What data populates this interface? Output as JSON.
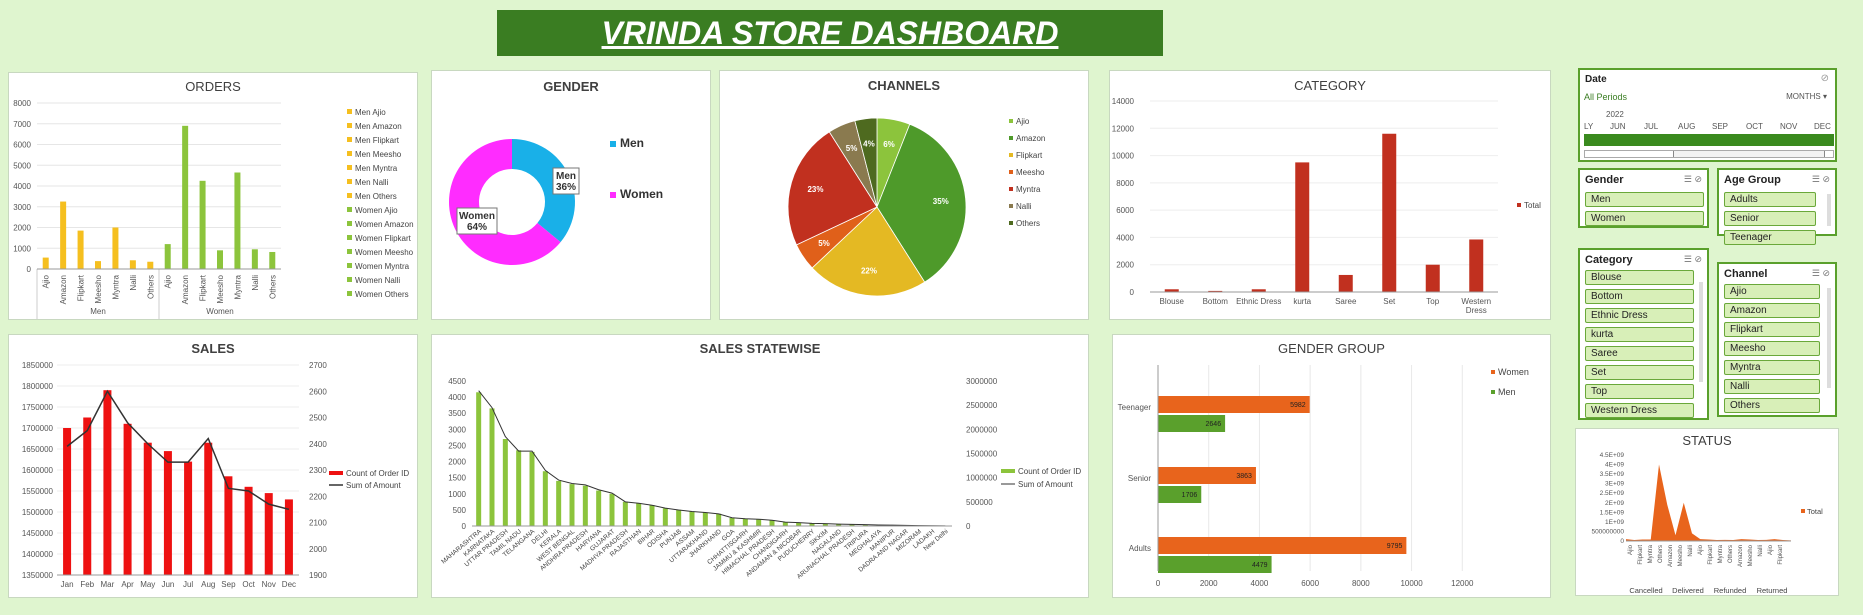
{
  "banner": {
    "title": "VRINDA STORE DASHBOARD"
  },
  "orders": {
    "title": "ORDERS",
    "y_ticks": [
      "8000",
      "7000",
      "6000",
      "5000",
      "4000",
      "3000",
      "2000",
      "1000",
      "0"
    ],
    "groups": [
      "Men",
      "Women"
    ],
    "legend": [
      "Men Ajio",
      "Men Amazon",
      "Men Flipkart",
      "Men Meesho",
      "Men Myntra",
      "Men Nalli",
      "Men Others",
      "Women Ajio",
      "Women Amazon",
      "Women Flipkart",
      "Women Meesho",
      "Women Myntra",
      "Women Nalli",
      "Women Others"
    ]
  },
  "gender": {
    "title": "GENDER",
    "legend": [
      "Men",
      "Women"
    ],
    "men_label": "Men",
    "men_pct": "36%",
    "women_label": "Women",
    "women_pct": "64%"
  },
  "channels": {
    "title": "CHANNELS",
    "legend": [
      "Ajio",
      "Amazon",
      "Flipkart",
      "Meesho",
      "Myntra",
      "Nalli",
      "Others"
    ],
    "pct_labels": [
      "6%",
      "35%",
      "22%",
      "5%",
      "23%",
      "5%",
      "4%"
    ]
  },
  "category": {
    "title": "CATEGORY",
    "y_ticks": [
      "14000",
      "12000",
      "10000",
      "8000",
      "6000",
      "4000",
      "2000",
      "0"
    ],
    "legend": "Total"
  },
  "sales": {
    "title": "SALES",
    "y_left": [
      "1850000",
      "1800000",
      "1750000",
      "1700000",
      "1650000",
      "1600000",
      "1550000",
      "1500000",
      "1450000",
      "1400000",
      "1350000"
    ],
    "y_right": [
      "2700",
      "2600",
      "2500",
      "2400",
      "2300",
      "2200",
      "2100",
      "2000",
      "1900"
    ],
    "legend": [
      "Count of Order ID",
      "Sum of Amount"
    ]
  },
  "statewise": {
    "title": "SALES STATEWISE",
    "y_left": [
      "4500",
      "4000",
      "3500",
      "3000",
      "2500",
      "2000",
      "1500",
      "1000",
      "500",
      "0"
    ],
    "y_right": [
      "3000000",
      "2500000",
      "2000000",
      "1500000",
      "1000000",
      "500000",
      "0"
    ],
    "legend": [
      "Count of Order ID",
      "Sum of Amount"
    ]
  },
  "gender_group": {
    "title": "GENDER GROUP",
    "x_ticks": [
      "0",
      "2000",
      "4000",
      "6000",
      "8000",
      "10000",
      "12000"
    ],
    "legend": [
      "Women",
      "Men"
    ]
  },
  "status": {
    "title": "STATUS",
    "y_ticks": [
      "4.5E+09",
      "4E+09",
      "3.5E+09",
      "3E+09",
      "2.5E+09",
      "2E+09",
      "1.5E+09",
      "1E+09",
      "500000000",
      "0"
    ],
    "groups": [
      "Cancelled",
      "Delivered",
      "Refunded",
      "Returned"
    ],
    "channels": [
      "Ajio",
      "Flipkart",
      "Myntra",
      "Others",
      "Amazon",
      "Meesho",
      "Nalli"
    ],
    "legend": "Total"
  },
  "date_slicer": {
    "title": "Date",
    "period": "All Periods",
    "unit": "MONTHS",
    "year": "2022",
    "months": [
      "LY",
      "JUN",
      "JUL",
      "AUG",
      "SEP",
      "OCT",
      "NOV",
      "DEC"
    ]
  },
  "gender_slicer": {
    "title": "Gender",
    "items": [
      "Men",
      "Women"
    ]
  },
  "age_slicer": {
    "title": "Age Group",
    "items": [
      "Adults",
      "Senior",
      "Teenager"
    ]
  },
  "category_slicer": {
    "title": "Category",
    "items": [
      "Blouse",
      "Bottom",
      "Ethnic Dress",
      "kurta",
      "Saree",
      "Set",
      "Top",
      "Western Dress"
    ]
  },
  "channel_slicer": {
    "title": "Channel",
    "items": [
      "Ajio",
      "Amazon",
      "Flipkart",
      "Meesho",
      "Myntra",
      "Nalli",
      "Others"
    ]
  },
  "chart_data": [
    {
      "type": "bar",
      "title": "ORDERS",
      "categories": [
        "Ajio",
        "Amazon",
        "Flipkart",
        "Meesho",
        "Myntra",
        "Nalli",
        "Others"
      ],
      "series": [
        {
          "name": "Men",
          "values": [
            550,
            3250,
            1850,
            380,
            2000,
            420,
            350
          ]
        },
        {
          "name": "Women",
          "values": [
            1200,
            6900,
            4250,
            900,
            4650,
            950,
            820
          ]
        }
      ],
      "ylim": [
        0,
        8000
      ]
    },
    {
      "type": "pie",
      "title": "GENDER",
      "categories": [
        "Men",
        "Women"
      ],
      "values": [
        36,
        64
      ]
    },
    {
      "type": "pie",
      "title": "CHANNELS",
      "categories": [
        "Ajio",
        "Amazon",
        "Flipkart",
        "Meesho",
        "Myntra",
        "Nalli",
        "Others"
      ],
      "values": [
        6,
        35,
        22,
        5,
        23,
        5,
        4
      ]
    },
    {
      "type": "bar",
      "title": "CATEGORY",
      "categories": [
        "Blouse",
        "Bottom",
        "Ethnic Dress",
        "kurta",
        "Saree",
        "Set",
        "Top",
        "Western Dress"
      ],
      "values": [
        200,
        80,
        200,
        9500,
        1250,
        11600,
        2000,
        3850
      ],
      "ylim": [
        0,
        14000
      ],
      "series_name": "Total"
    },
    {
      "type": "bar",
      "title": "SALES",
      "categories": [
        "Jan",
        "Feb",
        "Mar",
        "Apr",
        "May",
        "Jun",
        "Jul",
        "Aug",
        "Sep",
        "Oct",
        "Nov",
        "Dec"
      ],
      "series": [
        {
          "name": "Count of Order ID",
          "values": [
            1700000,
            1725000,
            1790000,
            1710000,
            1665000,
            1645000,
            1620000,
            1665000,
            1585000,
            1560000,
            1545000,
            1530000
          ]
        },
        {
          "name": "Sum of Amount",
          "values": [
            2390,
            2450,
            2600,
            2480,
            2400,
            2330,
            2330,
            2420,
            2230,
            2220,
            2170,
            2150
          ]
        }
      ],
      "ylim": [
        1350000,
        1850000
      ],
      "y2lim": [
        1900,
        2700
      ]
    },
    {
      "type": "bar",
      "title": "SALES STATEWISE",
      "categories": [
        "MAHARASHTRA",
        "KARNATAKA",
        "UTTAR PRADESH",
        "TAMIL NADU",
        "TELANGANA",
        "DELHI",
        "KERALA",
        "WEST BENGAL",
        "ANDHRA PRADESH",
        "HARYANA",
        "GUJARAT",
        "MADHYA PRADESH",
        "RAJASTHAN",
        "BIHAR",
        "ODISHA",
        "PUNJAB",
        "ASSAM",
        "UTTARAKHAND",
        "JHARKHAND",
        "GOA",
        "CHHATTISGARH",
        "JAMMU & KASHMIR",
        "HIMACHAL PRADESH",
        "CHANDIGARH",
        "ANDAMAN & NICOBAR",
        "PUDUCHERRY",
        "SIKKIM",
        "NAGALAND",
        "ARUNACHAL PRADESH",
        "TRIPURA",
        "MEGHALAYA",
        "MANIPUR",
        "DADRA AND NAGAR",
        "MIZORAM",
        "LADAKH",
        "New Delhi"
      ],
      "series": [
        {
          "name": "Count of Order ID",
          "values": [
            4150,
            3650,
            2700,
            2350,
            2300,
            1700,
            1400,
            1300,
            1250,
            1100,
            1000,
            750,
            700,
            650,
            550,
            500,
            450,
            420,
            380,
            250,
            220,
            200,
            180,
            120,
            100,
            80,
            70,
            60,
            50,
            40,
            30,
            25,
            20,
            10,
            8,
            5
          ]
        },
        {
          "name": "Sum of Amount",
          "values": [
            2800000,
            2450000,
            1850000,
            1550000,
            1550000,
            1150000,
            950000,
            880000,
            850000,
            750000,
            680000,
            500000,
            470000,
            430000,
            370000,
            330000,
            300000,
            280000,
            250000,
            170000,
            150000,
            140000,
            120000,
            80000,
            70000,
            55000,
            48000,
            40000,
            34000,
            28000,
            20000,
            17000,
            14000,
            7000,
            5000,
            3000
          ]
        }
      ],
      "ylim": [
        0,
        4500
      ],
      "y2lim": [
        0,
        3000000
      ]
    },
    {
      "type": "bar",
      "title": "GENDER GROUP",
      "categories": [
        "Adults",
        "Senior",
        "Teenager"
      ],
      "series": [
        {
          "name": "Women",
          "values": [
            9795,
            3863,
            5982
          ]
        },
        {
          "name": "Men",
          "values": [
            4479,
            1706,
            2646
          ]
        }
      ],
      "xlim": [
        0,
        12000
      ]
    },
    {
      "type": "area",
      "title": "STATUS",
      "categories": [
        "Cancelled",
        "Delivered",
        "Refunded",
        "Returned"
      ],
      "series": [
        {
          "name": "Total",
          "values": [
            100000000,
            50000000,
            80000000,
            80000000,
            4000000000,
            1900000000,
            300000000,
            2000000000,
            400000000,
            100000000,
            80000000,
            50000000,
            60000000,
            50000000,
            100000000,
            80000000,
            50000000,
            60000000,
            100000000,
            50000000,
            30000000
          ]
        }
      ],
      "ylim": [
        0,
        4500000000
      ]
    }
  ]
}
